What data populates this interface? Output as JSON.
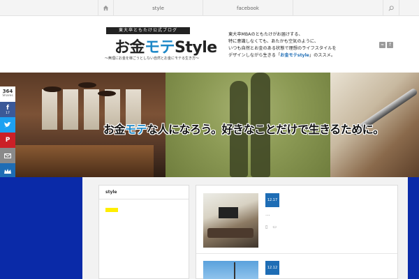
{
  "topnav": {
    "items": [
      "style",
      "facebook"
    ]
  },
  "header": {
    "logo_band": "東大卒ともたけ公式ブログ",
    "logo_main_a": "お金",
    "logo_main_b": "モテ",
    "logo_main_c": "Style",
    "logo_sub": "〜無理にお金を稼ごうとしない自然とお金にモテる生き方〜",
    "tagline": [
      "東大卒MBAのともたけがお届けする、",
      "特に意識しなくても、あたかも空気のように、",
      "いつも自然とお金のある状態で理想のライフスタイルを",
      "デザインしながら生きる「お金モテstyle」のススメ。"
    ],
    "tagline_highlight": "お金モテstyle"
  },
  "banner": {
    "catch_a": "お金",
    "catch_b": "モテ",
    "catch_c": "な人になろう。好きなことだけで生きるために。"
  },
  "share": {
    "count": "364",
    "count_label": "Shares",
    "facebook_count": "17"
  },
  "sidebar": {
    "title": "style"
  },
  "posts": [
    {
      "date": "12.17",
      "excerpt": "..."
    },
    {
      "date": "12.12"
    }
  ],
  "colors": {
    "accent": "#1e88c7",
    "navy": "#0a2aa8",
    "facebook": "#3b5998",
    "twitter": "#1da1f2",
    "pinterest": "#cb2027",
    "highlight": "#ffee00"
  }
}
